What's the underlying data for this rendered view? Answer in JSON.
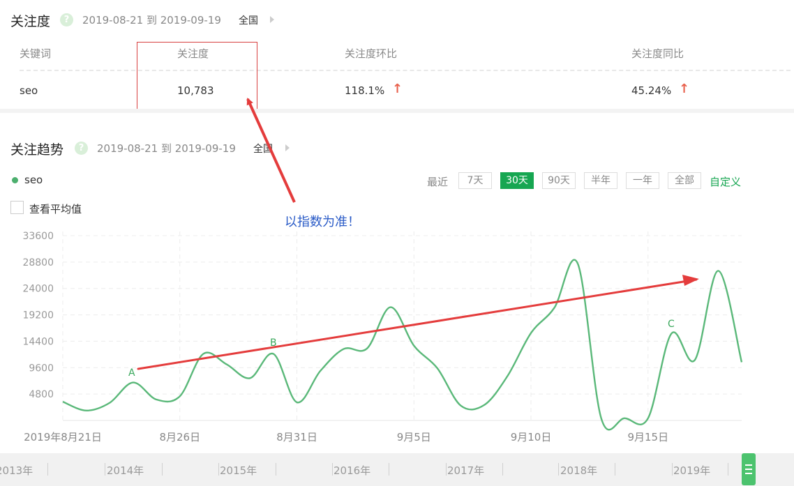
{
  "attention": {
    "title": "关注度",
    "help_symbol": "?",
    "date_range": "2019-08-21 到 2019-09-19",
    "region": "全国",
    "columns": [
      "关键词",
      "关注度",
      "关注度环比",
      "关注度同比"
    ],
    "row": {
      "keyword": "seo",
      "value": "10,783",
      "mom": "118.1%",
      "yoy": "45.24%"
    },
    "up_arrow": "↑"
  },
  "trend": {
    "title": "关注趋势",
    "help_symbol": "?",
    "date_range": "2019-08-21 到 2019-09-19",
    "region": "全国",
    "legend": "seo",
    "recent_label": "最近",
    "range_buttons": [
      "7天",
      "30天",
      "90天",
      "半年",
      "一年",
      "全部"
    ],
    "active_range": "30天",
    "custom_label": "自定义",
    "average_checkbox_label": "查看平均值",
    "average_checked": false
  },
  "annotation": {
    "note": "以指数为准！",
    "point_labels": [
      "A",
      "B",
      "C"
    ]
  },
  "chart_data": {
    "type": "line",
    "y_ticks": [
      "33600",
      "28800",
      "24000",
      "19200",
      "14400",
      "9600",
      "4800"
    ],
    "ylim": [
      0,
      33600
    ],
    "x_tick_labels": [
      "2019年8月21日",
      "8月26日",
      "8月31日",
      "9月5日",
      "9月10日",
      "9月15日"
    ],
    "x_tick_indices": [
      0,
      5,
      10,
      15,
      20,
      25
    ],
    "grid": true,
    "series": [
      {
        "name": "seo",
        "color": "#5ab879",
        "values": [
          3400,
          1800,
          3200,
          6900,
          3800,
          4400,
          12100,
          10200,
          7700,
          12100,
          3300,
          9000,
          13000,
          13100,
          20600,
          13600,
          9500,
          2700,
          2800,
          8100,
          15900,
          20500,
          28500,
          400,
          400,
          400,
          15800,
          11000,
          27200,
          10600
        ]
      }
    ]
  },
  "timeline": {
    "years": [
      "2013年",
      "2014年",
      "2015年",
      "2016年",
      "2017年",
      "2018年",
      "2019年"
    ]
  }
}
